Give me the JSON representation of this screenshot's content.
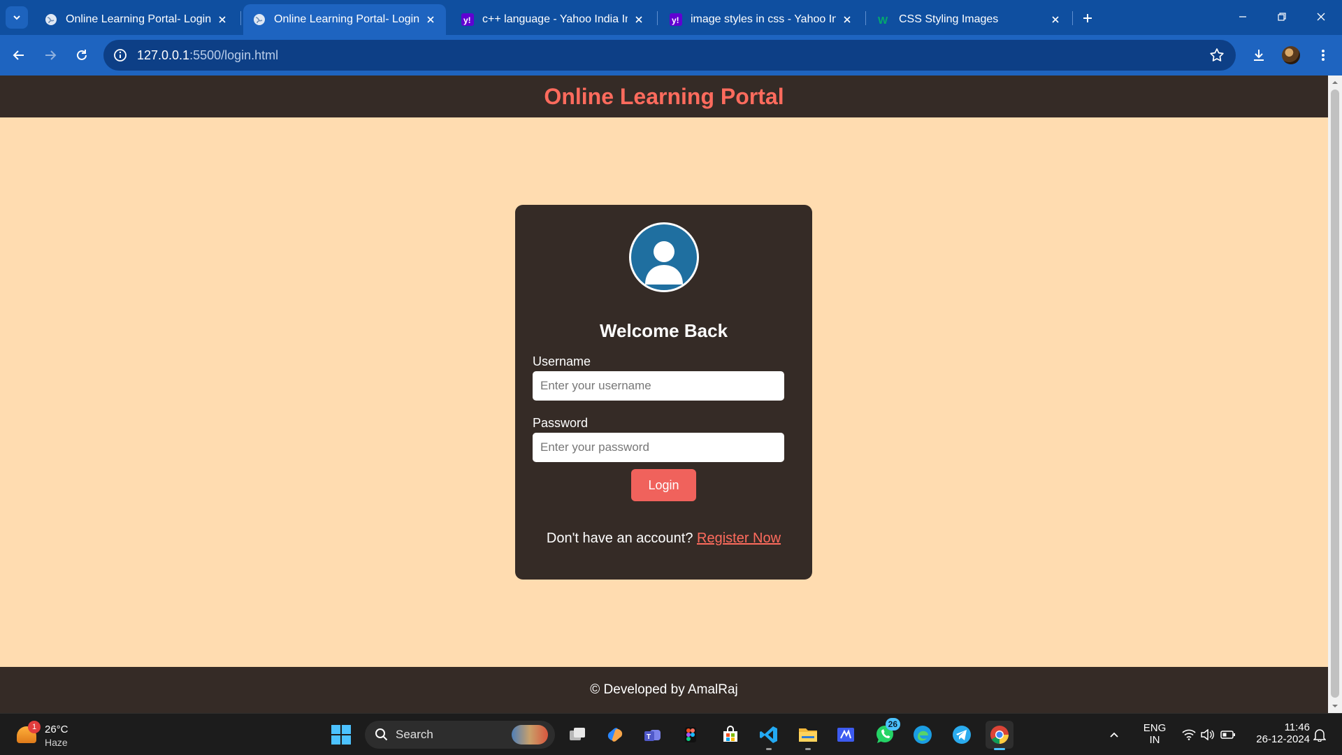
{
  "browser": {
    "tabs": [
      {
        "title": "Online Learning Portal- Login",
        "favicon": "globe-icon",
        "active": false
      },
      {
        "title": "Online Learning Portal- Login",
        "favicon": "globe-icon",
        "active": true
      },
      {
        "title": "c++ language - Yahoo India Ima",
        "favicon": "yahoo-icon",
        "active": false
      },
      {
        "title": "image styles in css - Yahoo India",
        "favicon": "yahoo-icon",
        "active": false
      },
      {
        "title": "CSS Styling Images",
        "favicon": "w3schools-icon",
        "active": false
      }
    ],
    "address": {
      "host": "127.0.0.1",
      "path": ":5500/login.html"
    }
  },
  "page": {
    "header_title": "Online Learning Portal",
    "card": {
      "heading": "Welcome Back",
      "username_label": "Username",
      "username_placeholder": "Enter your username",
      "password_label": "Password",
      "password_placeholder": "Enter your password",
      "login_button": "Login",
      "register_prompt": "Don't have an account?",
      "register_link": "Register Now"
    },
    "footer_text": "© Developed by AmalRaj"
  },
  "taskbar": {
    "weather": {
      "temp": "26°C",
      "desc": "Haze",
      "badge": "1"
    },
    "search_label": "Search",
    "whatsapp_badge": "26",
    "language": {
      "line1": "ENG",
      "line2": "IN"
    },
    "clock": {
      "time": "11:46",
      "date": "26-12-2024"
    }
  },
  "colors": {
    "accent": "#ff6b5d",
    "page_bg": "#ffdcb0",
    "dark": "#352b26",
    "browser_blue": "#1e64c0"
  }
}
